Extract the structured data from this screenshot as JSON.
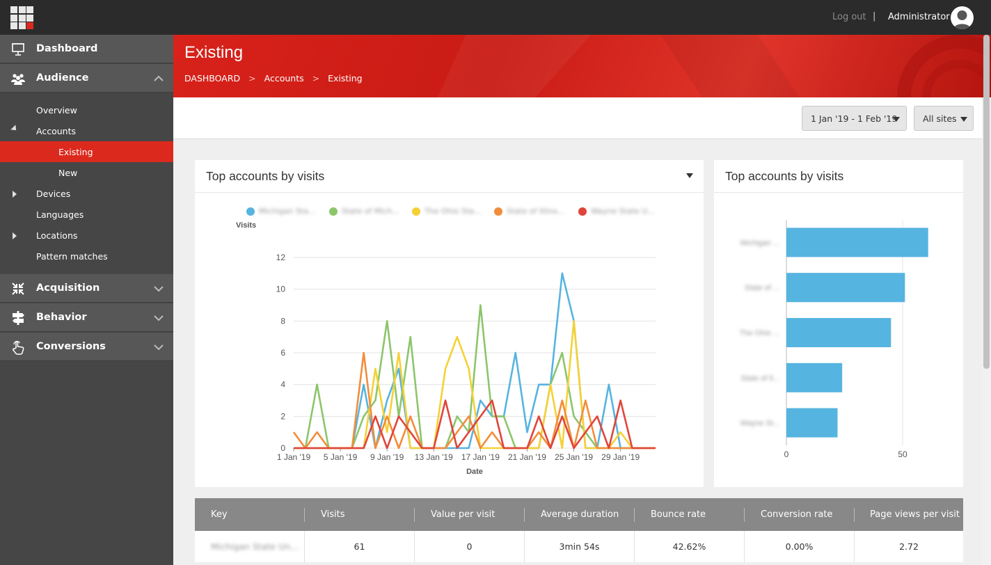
{
  "topbar": {
    "logout": "Log out",
    "separator": "|",
    "user": "Administrator"
  },
  "sidebar": {
    "main": [
      {
        "label": "Dashboard",
        "icon": "presentation-icon"
      },
      {
        "label": "Audience",
        "icon": "people-icon"
      },
      {
        "label": "Acquisition",
        "icon": "arrows-in-icon"
      },
      {
        "label": "Behavior",
        "icon": "signpost-icon"
      },
      {
        "label": "Conversions",
        "icon": "hand-pointer-icon"
      }
    ],
    "sub": [
      "Overview",
      "Accounts",
      "Existing",
      "New",
      "Devices",
      "Languages",
      "Locations",
      "Pattern matches"
    ]
  },
  "header": {
    "title": "Existing",
    "crumbs": [
      "DASHBOARD",
      "Accounts",
      "Existing"
    ],
    "crumb_sep": ">"
  },
  "filters": {
    "date_range": "1 Jan '19 - 1 Feb '19",
    "sites": "All sites"
  },
  "colors": {
    "accent": "#dc291e",
    "blue": "#56b4e0",
    "green": "#8cc56b",
    "yellow": "#f5d136",
    "orange": "#f28d3a",
    "red": "#e0443a"
  },
  "chart_data": [
    {
      "type": "line",
      "title": "Top accounts by visits",
      "xlabel": "Date",
      "ylabel": "Visits",
      "ylim": [
        0,
        12
      ],
      "yticks": [
        0,
        2,
        4,
        6,
        8,
        10,
        12
      ],
      "xtick_labels": [
        "1 Jan '19",
        "5 Jan '19",
        "9 Jan '19",
        "13 Jan '19",
        "17 Jan '19",
        "21 Jan '19",
        "25 Jan '19",
        "29 Jan '19"
      ],
      "x": [
        1,
        2,
        3,
        4,
        5,
        6,
        7,
        8,
        9,
        10,
        11,
        12,
        13,
        14,
        15,
        16,
        17,
        18,
        19,
        20,
        21,
        22,
        23,
        24,
        25,
        26,
        27,
        28,
        29,
        30,
        31,
        32
      ],
      "legend_labels": [
        "Michigan Sta...",
        "State of Mich...",
        "The Ohio Sta...",
        "State of Illino...",
        "Wayne State U..."
      ],
      "series": [
        {
          "values": [
            0,
            0,
            0,
            0,
            0,
            0,
            4,
            0,
            3,
            5,
            0,
            0,
            0,
            0,
            0,
            0,
            3,
            2,
            2,
            6,
            1,
            4,
            4,
            11,
            8,
            0,
            0,
            4,
            0,
            0,
            0,
            0
          ]
        },
        {
          "values": [
            0,
            0,
            4,
            0,
            0,
            0,
            2,
            3,
            8,
            2,
            7,
            0,
            0,
            0,
            2,
            1,
            9,
            2,
            2,
            0,
            0,
            0,
            4,
            6,
            2,
            1,
            0,
            0,
            0,
            0,
            0,
            0
          ]
        },
        {
          "values": [
            0,
            0,
            0,
            0,
            0,
            0,
            0,
            5,
            1,
            6,
            0,
            0,
            0,
            5,
            7,
            5,
            0,
            0,
            0,
            0,
            0,
            0,
            4,
            0,
            8,
            0,
            0,
            0,
            1,
            0,
            0,
            0
          ]
        },
        {
          "values": [
            1,
            0,
            1,
            0,
            0,
            0,
            6,
            0,
            2,
            0,
            2,
            0,
            0,
            0,
            1,
            2,
            0,
            1,
            0,
            0,
            0,
            1,
            0,
            3,
            0,
            3,
            0,
            0,
            0,
            0,
            0,
            0
          ]
        },
        {
          "values": [
            0,
            0,
            0,
            0,
            0,
            0,
            0,
            2,
            0,
            2,
            1,
            0,
            0,
            3,
            0,
            1,
            2,
            3,
            0,
            0,
            0,
            2,
            0,
            2,
            0,
            1,
            2,
            0,
            3,
            0,
            0,
            0
          ]
        }
      ]
    },
    {
      "type": "bar",
      "title": "Top accounts by visits",
      "orientation": "horizontal",
      "categories": [
        "Michigan ...",
        "State of ...",
        "The Ohio ...",
        "State of Il...",
        "Wayne St..."
      ],
      "values": [
        61,
        51,
        45,
        24,
        22
      ],
      "xticks": [
        0,
        50
      ]
    }
  ],
  "table": {
    "headers": [
      "Key",
      "Visits",
      "Value per visit",
      "Average duration",
      "Bounce rate",
      "Conversion rate",
      "Page views per visit"
    ],
    "rows": [
      [
        "Michigan State Un...",
        "61",
        "0",
        "3min 54s",
        "42.62%",
        "0.00%",
        "2.72"
      ]
    ]
  }
}
